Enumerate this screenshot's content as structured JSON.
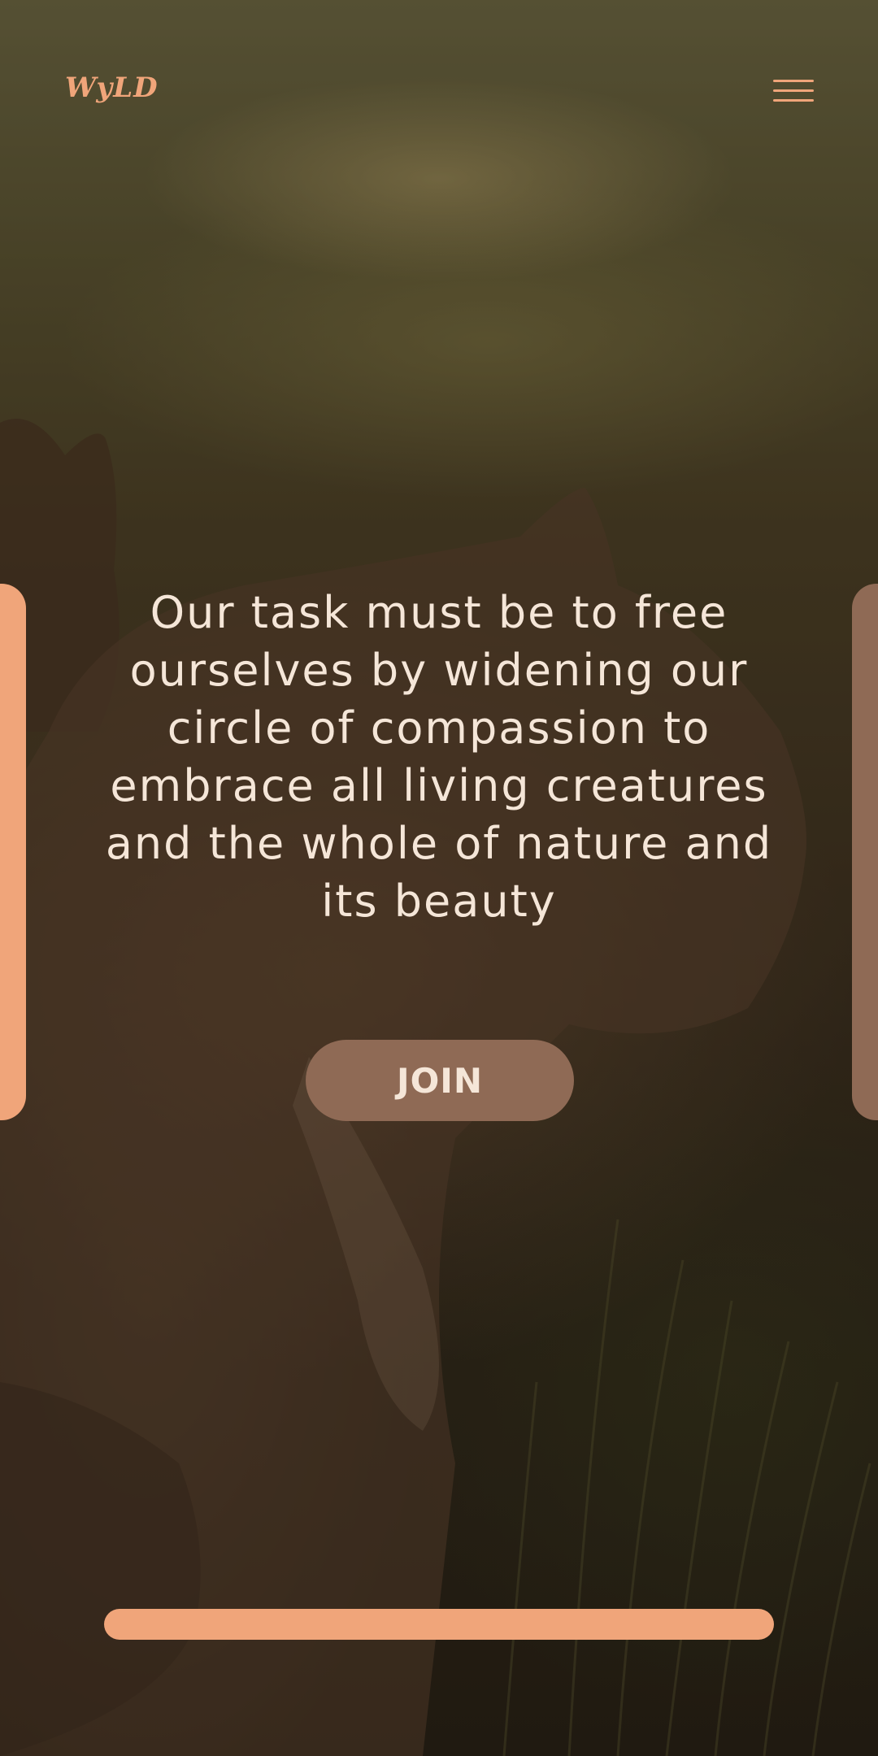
{
  "header": {
    "logo_text": "WyLD",
    "menu_icon": "hamburger-menu-icon"
  },
  "hero": {
    "quote": "Our task must be to free ourselves by widening our circle of compassion to embrace all living creatures and the whole of nature and its beauty",
    "join_label": "JOIN"
  },
  "colors": {
    "accent": "#f0a57a",
    "button": "#8f6a55",
    "text": "#f5e6d8"
  }
}
